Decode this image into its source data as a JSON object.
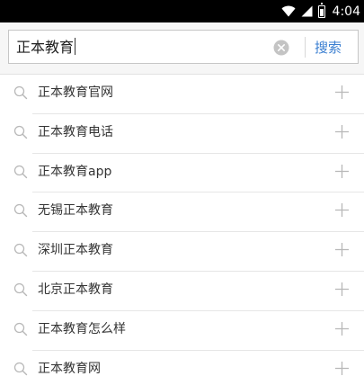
{
  "status_bar": {
    "time": "4:04",
    "wifi_icon": "wifi-icon",
    "signal_icon": "signal-icon",
    "battery_icon": "battery-icon"
  },
  "search": {
    "query": "正本教育",
    "clear_icon": "clear-icon",
    "button_label": "搜索"
  },
  "suggestions": [
    {
      "label": "正本教育官网"
    },
    {
      "label": "正本教育电话"
    },
    {
      "label": "正本教育app"
    },
    {
      "label": "无锡正本教育"
    },
    {
      "label": "深圳正本教育"
    },
    {
      "label": "北京正本教育"
    },
    {
      "label": "正本教育怎么样"
    },
    {
      "label": "正本教育网"
    }
  ],
  "colors": {
    "status_bar": "#000000",
    "header_bg": "#f6f6f6",
    "accent": "#3b7fd1",
    "text": "#333333",
    "divider": "#e6e6e6",
    "icon_gray": "#b8b8b8"
  }
}
